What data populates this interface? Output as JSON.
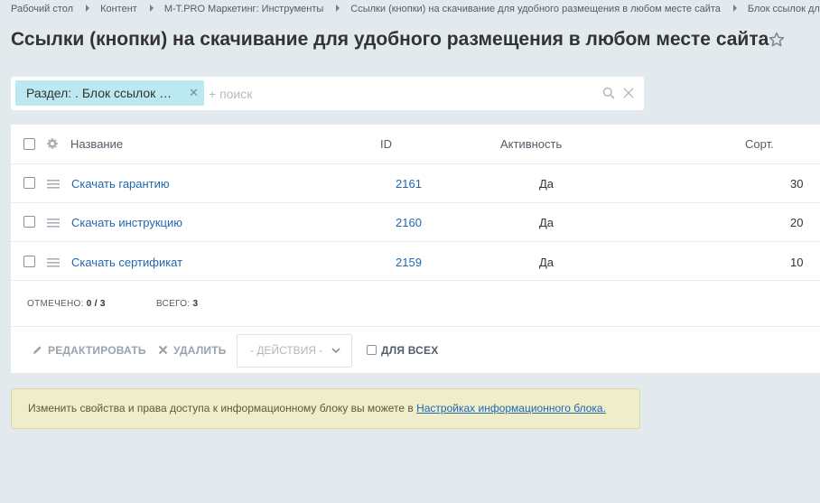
{
  "breadcrumbs": [
    "Рабочий стол",
    "Контент",
    "M-T.PRO Маркетинг: Инструменты",
    "Ссылки (кнопки) на скачивание для удобного размещения в любом месте сайта",
    "Блок ссылок для скачивания"
  ],
  "page_title": "Ссылки (кнопки) на скачивание для удобного размещения в любом месте сайта",
  "filter": {
    "tag_label": "Раздел: . Блок ссылок …",
    "search_placeholder": "+ поиск",
    "search_value": ""
  },
  "grid": {
    "columns": {
      "name": "Название",
      "id": "ID",
      "active": "Активность",
      "sort": "Сорт."
    },
    "rows": [
      {
        "name": "Скачать гарантию",
        "id": "2161",
        "active": "Да",
        "sort": "30"
      },
      {
        "name": "Скачать инструкцию",
        "id": "2160",
        "active": "Да",
        "sort": "20"
      },
      {
        "name": "Скачать сертификат",
        "id": "2159",
        "active": "Да",
        "sort": "10"
      }
    ],
    "selected_label": "ОТМЕЧЕНО:",
    "selected_value": "0 / 3",
    "total_label": "ВСЕГО:",
    "total_value": "3"
  },
  "actions": {
    "edit_label": "РЕДАКТИРОВАТЬ",
    "delete_label": "УДАЛИТЬ",
    "select_value": "- ДЕЙСТВИЯ -",
    "for_all_label": "ДЛЯ ВСЕХ"
  },
  "notice": {
    "text": "Изменить свойства и права доступа к информационному блоку вы можете в ",
    "link_text": "Настройках информационного блока."
  },
  "colors": {
    "background": "#e3eaed",
    "link": "#2067b0",
    "filter_tag": "#bce8f1",
    "notice_bg": "#efedca"
  },
  "icons": [
    "star-icon",
    "search-icon",
    "close-icon",
    "gear-icon",
    "drag-handle-icon",
    "pencil-icon",
    "delete-icon",
    "chevron-down-icon"
  ]
}
